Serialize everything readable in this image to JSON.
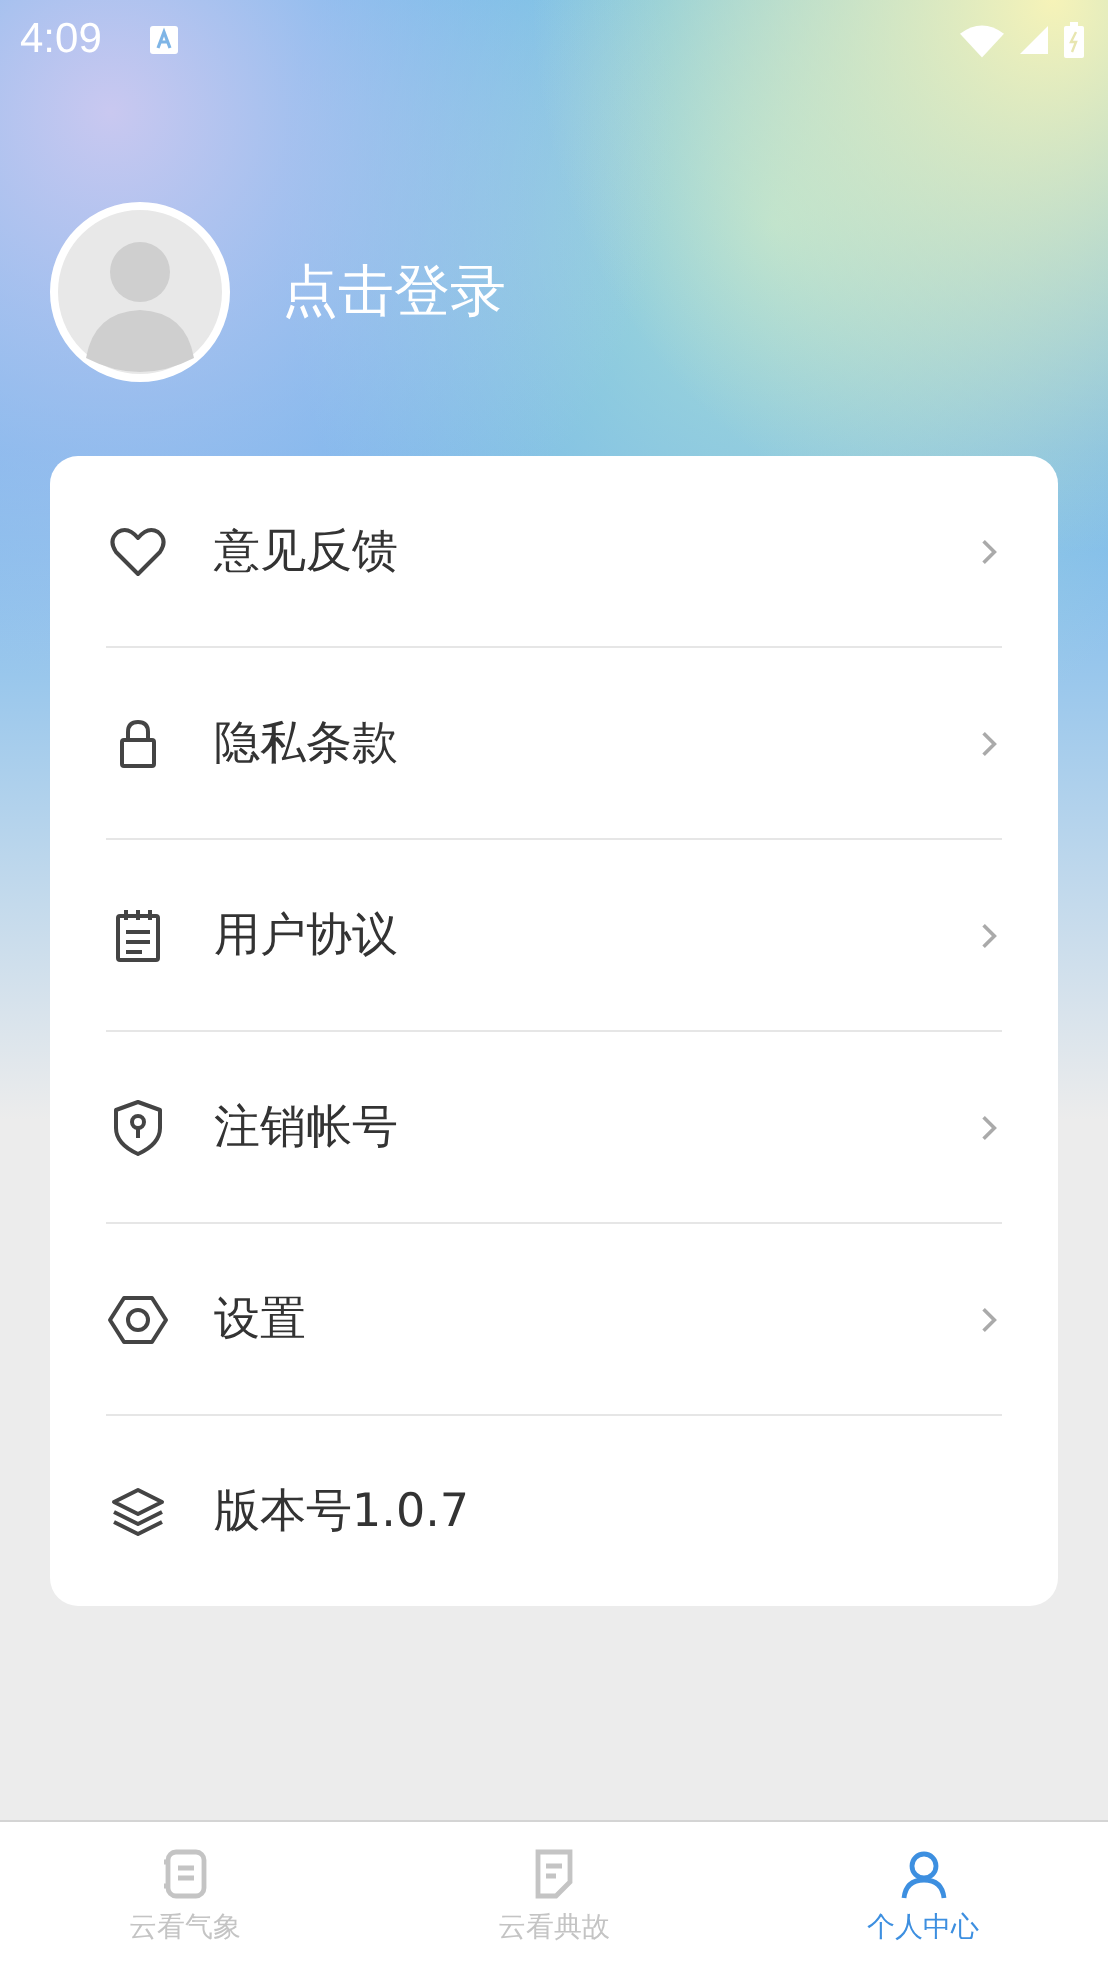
{
  "status_bar": {
    "time": "4:09"
  },
  "profile": {
    "login_label": "点击登录"
  },
  "menu": [
    {
      "label": "意见反馈",
      "kind": "link"
    },
    {
      "label": "隐私条款",
      "kind": "link"
    },
    {
      "label": "用户协议",
      "kind": "link"
    },
    {
      "label": "注销帐号",
      "kind": "link"
    },
    {
      "label": "设置",
      "kind": "link"
    },
    {
      "label": "版本号1.0.7",
      "kind": "info"
    }
  ],
  "tabs": [
    {
      "label": "云看气象",
      "selected": false
    },
    {
      "label": "云看典故",
      "selected": false
    },
    {
      "label": "个人中心",
      "selected": true
    }
  ]
}
